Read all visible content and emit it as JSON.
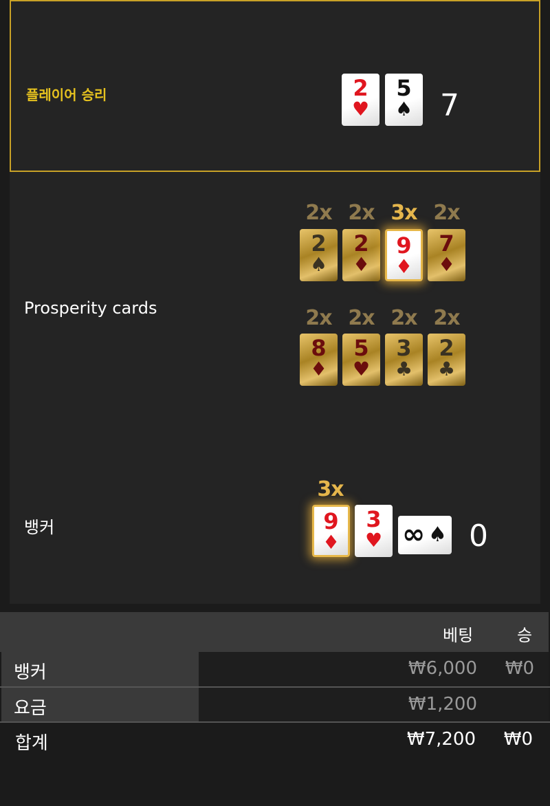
{
  "player": {
    "label": "플레이어 승리",
    "cards": [
      {
        "rank": "2",
        "suit": "♥",
        "color": "red"
      },
      {
        "rank": "5",
        "suit": "♠",
        "color": "black"
      }
    ],
    "score": "7"
  },
  "prosperity": {
    "label": "Prosperity cards",
    "row1": {
      "multipliers": [
        "2x",
        "2x",
        "3x",
        "2x"
      ],
      "cards": [
        {
          "rank": "2",
          "suit": "♠",
          "color": "black"
        },
        {
          "rank": "2",
          "suit": "♦",
          "color": "red"
        },
        {
          "rank": "9",
          "suit": "♦",
          "color": "red",
          "highlighted": true
        },
        {
          "rank": "7",
          "suit": "♦",
          "color": "red"
        }
      ]
    },
    "row2": {
      "multipliers": [
        "2x",
        "2x",
        "2x",
        "2x"
      ],
      "cards": [
        {
          "rank": "8",
          "suit": "♦",
          "color": "red"
        },
        {
          "rank": "5",
          "suit": "♥",
          "color": "red"
        },
        {
          "rank": "3",
          "suit": "♣",
          "color": "black"
        },
        {
          "rank": "2",
          "suit": "♣",
          "color": "black"
        }
      ]
    }
  },
  "banker": {
    "label": "뱅커",
    "multiplier": "3x",
    "cards": [
      {
        "rank": "9",
        "suit": "♦",
        "color": "red",
        "highlighted": true
      },
      {
        "rank": "3",
        "suit": "♥",
        "color": "red"
      }
    ],
    "wild_card": {
      "symbol": "∞",
      "suit": "♠"
    },
    "score": "0"
  },
  "summary": {
    "headers": {
      "bet": "베팅",
      "win": "승"
    },
    "rows": [
      {
        "label": "뱅커",
        "bet": "₩6,000",
        "win": "₩0"
      },
      {
        "label": "요금",
        "bet": "₩1,200",
        "win": ""
      }
    ],
    "total": {
      "label": "합계",
      "bet": "₩7,200",
      "win": "₩0"
    }
  },
  "colors": {
    "gold_accent": "#c9a227",
    "panel_bg": "#242424",
    "card_red": "#e0161f"
  }
}
